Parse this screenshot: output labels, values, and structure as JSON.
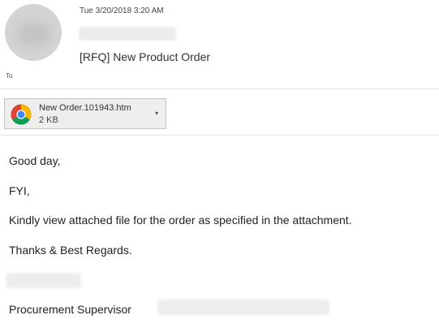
{
  "header": {
    "timestamp": "Tue 3/20/2018 3:20 AM",
    "subject": "[RFQ] New Product Order",
    "to_label": "To"
  },
  "attachment": {
    "name": "New Order.101943.htm",
    "size": "2 KB",
    "icon": "chrome-icon",
    "dropdown_glyph": "▾"
  },
  "body": {
    "greeting": "Good day,",
    "fyi": "FYI,",
    "message": "Kindly view attached file for the order as specified in the attachment.",
    "closing": "Thanks & Best Regards.",
    "signature_title": "Procurement Supervisor"
  },
  "colors": {
    "background": "#ffffff",
    "attachment_bg": "#eeeeee",
    "attachment_border": "#c6c6c6"
  }
}
